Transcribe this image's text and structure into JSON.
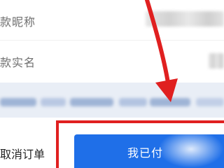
{
  "form": {
    "nickname_label": "款昵称",
    "realname_label": "款实名"
  },
  "order_actions": {
    "cancel_label": "取消订单",
    "paid_label": "我已付"
  },
  "annotation": {
    "highlight_color": "#e02020",
    "button_color": "#1f6fe8"
  }
}
